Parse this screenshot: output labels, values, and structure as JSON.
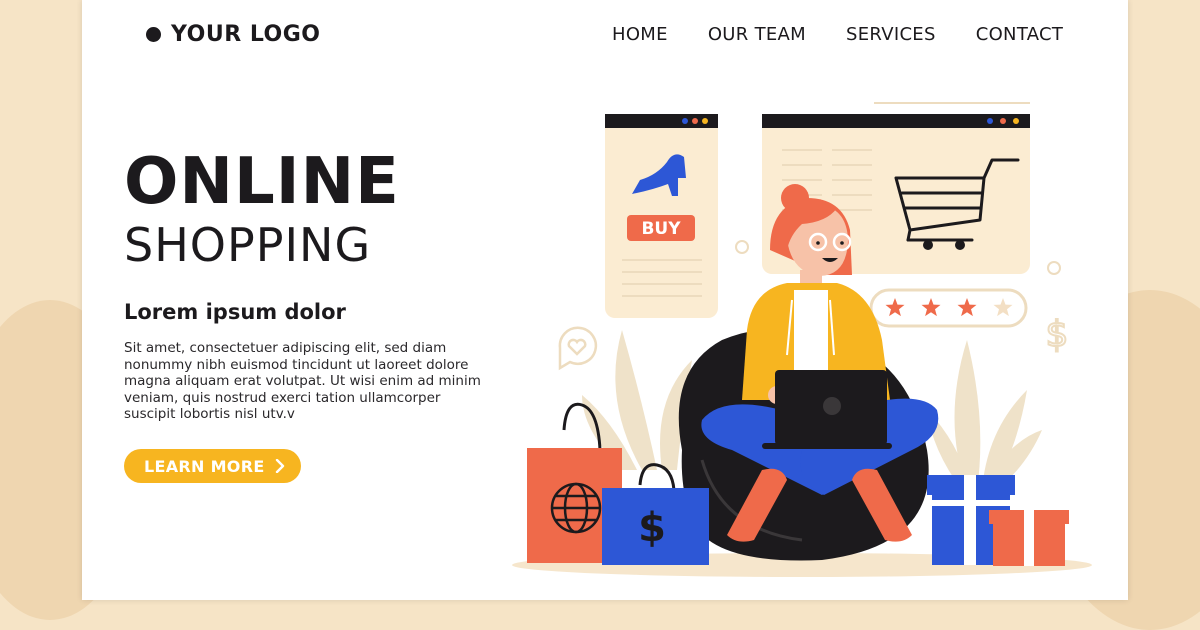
{
  "brand": {
    "logo_text": "YOUR LOGO"
  },
  "nav": {
    "items": [
      {
        "label": "HOME"
      },
      {
        "label": "OUR TEAM"
      },
      {
        "label": "SERVICES"
      },
      {
        "label": "CONTACT"
      }
    ]
  },
  "hero": {
    "title_line1": "ONLINE",
    "title_line2": "SHOPPING",
    "subtitle": "Lorem ipsum dolor",
    "body": "Sit amet, consectetuer adipiscing elit, sed diam nonummy nibh euismod tincidunt ut laoreet dolore magna aliquam erat volutpat. Ut wisi enim ad minim veniam, quis nostrud exerci tation ullamcorper suscipit lobortis nisl utv.v",
    "cta_label": "LEARN MORE",
    "cta_icon": "chevron-right-icon"
  },
  "illustration": {
    "buy_label": "BUY",
    "rating": 3,
    "rating_max": 4,
    "currency_symbol": "$",
    "colors": {
      "accent_yellow": "#f7b520",
      "accent_orange": "#ef6a4a",
      "accent_blue": "#2d57d6",
      "dark": "#1c1a1d",
      "cream": "#fbecd2"
    }
  }
}
